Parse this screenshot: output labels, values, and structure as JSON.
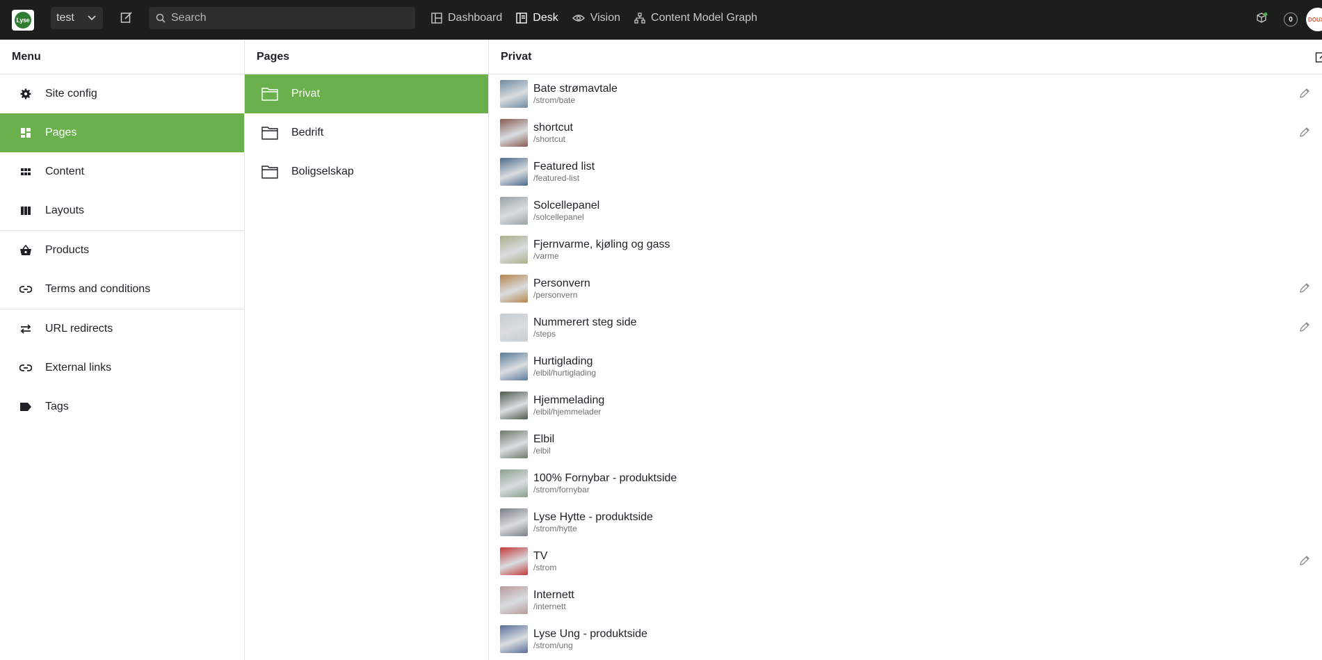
{
  "topbar": {
    "logo_text": "Lyse",
    "workspace": "test",
    "search_placeholder": "Search",
    "nav": [
      "Dashboard",
      "Desk",
      "Vision",
      "Content Model Graph"
    ],
    "notifications_count": "0",
    "avatar_text": "DOUX"
  },
  "menu": {
    "title": "Menu",
    "items": [
      "Site config",
      "Pages",
      "Content",
      "Layouts",
      "Products",
      "Terms and conditions",
      "URL redirects",
      "External links",
      "Tags"
    ],
    "active": "Pages"
  },
  "pages": {
    "title": "Pages",
    "folders": [
      "Privat",
      "Bedrift",
      "Boligselskap"
    ],
    "active": "Privat"
  },
  "privat": {
    "title": "Privat",
    "docs": [
      {
        "title": "Bate strømavtale",
        "slug": "/strom/bate",
        "color": "#6f8aa0",
        "edit": true
      },
      {
        "title": "shortcut",
        "slug": "/shortcut",
        "color": "#8a5a52",
        "edit": true
      },
      {
        "title": "Featured list",
        "slug": "/featured-list",
        "color": "#4d6a8c",
        "edit": false
      },
      {
        "title": "Solcellepanel",
        "slug": "/solcellepanel",
        "color": "#9aa3a8",
        "edit": false
      },
      {
        "title": "Fjernvarme, kjøling og gass",
        "slug": "/varme",
        "color": "#a8b08a",
        "edit": false
      },
      {
        "title": "Personvern",
        "slug": "/personvern",
        "color": "#b8844e",
        "edit": true
      },
      {
        "title": "Nummerert steg side",
        "slug": "/steps",
        "color": "#c6ccd0",
        "edit": true
      },
      {
        "title": "Hurtiglading",
        "slug": "/elbil/hurtiglading",
        "color": "#5c7a9a",
        "edit": false
      },
      {
        "title": "Hjemmelading",
        "slug": "/elbil/hjemmelader",
        "color": "#4e5a4c",
        "edit": false
      },
      {
        "title": "Elbil",
        "slug": "/elbil",
        "color": "#6e7a6a",
        "edit": false
      },
      {
        "title": "100% Fornybar - produktside",
        "slug": "/strom/fornybar",
        "color": "#8aa08c",
        "edit": false
      },
      {
        "title": "Lyse Hytte - produktside",
        "slug": "/strom/hytte",
        "color": "#7a7e86",
        "edit": false
      },
      {
        "title": "TV",
        "slug": "/strom",
        "color": "#c43a3a",
        "edit": true
      },
      {
        "title": "Internett",
        "slug": "/internett",
        "color": "#b89a9a",
        "edit": false
      },
      {
        "title": "Lyse Ung - produktside",
        "slug": "/strom/ung",
        "color": "#5a6e9a",
        "edit": false
      }
    ]
  },
  "colors": {
    "topbar": "#1c1e1c",
    "accent": "#6ab04c"
  }
}
